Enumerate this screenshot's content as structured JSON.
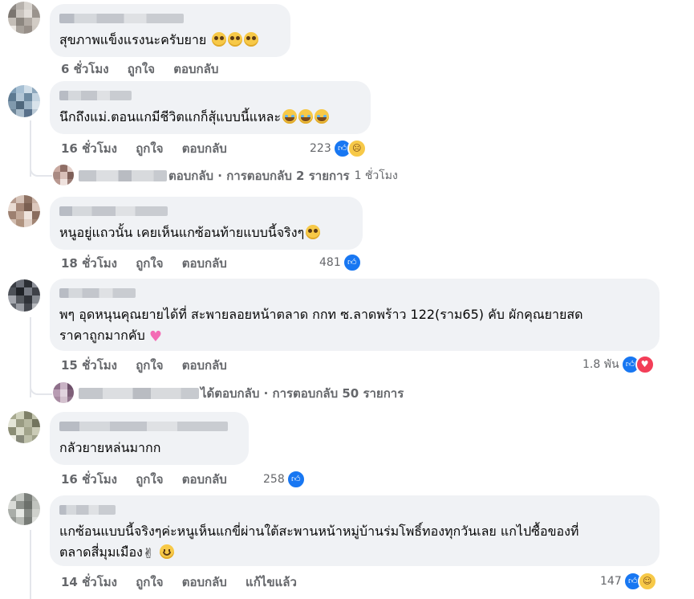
{
  "comments": [
    {
      "author": "",
      "text": "สุขภาพแข็งแรงนะครับยาย",
      "emojis": [
        "pleading-face",
        "pleading-face",
        "pleading-face"
      ],
      "time": "6 ชั่วโมง",
      "like_label": "ถูกใจ",
      "reply_label": "ตอบกลับ",
      "reaction_count": "",
      "reaction_icons": []
    },
    {
      "author": "",
      "text": "นึกถึงแม่.ตอนแกมีชีวิตแกก็สุ้แบบนี้แหละ",
      "emojis": [
        "crying-face",
        "crying-face",
        "crying-face"
      ],
      "time": "16 ชั่วโมง",
      "like_label": "ถูกใจ",
      "reply_label": "ตอบกลับ",
      "reaction_count": "223",
      "reaction_icons": [
        "like-icon",
        "sad-icon"
      ],
      "replies_summary": {
        "text": "ตอบกลับ · การตอบกลับ 2 รายการ",
        "time": "1 ชั่วโมง"
      }
    },
    {
      "author": "",
      "text": "หนูอยู่แถวนั้น เคยเห็นแกซ้อนท้ายแบบนี้จริงๆ",
      "emojis": [
        "pleading-face"
      ],
      "time": "18 ชั่วโมง",
      "like_label": "ถูกใจ",
      "reply_label": "ตอบกลับ",
      "reaction_count": "481",
      "reaction_icons": [
        "like-icon"
      ]
    },
    {
      "author": "",
      "text_line1": "พๆ อุดหนุนคุณยายได้ที่ สะพายลอยหน้าตลาด กกท ซ.ลาดพร้าว 122(ราม65) คับ ผักคุณยายสด",
      "text_line2": "ราคาถูกมากคับ",
      "emojis": [
        "pink-heart"
      ],
      "time": "15 ชั่วโมง",
      "like_label": "ถูกใจ",
      "reply_label": "ตอบกลับ",
      "reaction_count": "1.8 พัน",
      "reaction_icons": [
        "like-icon",
        "love-icon"
      ],
      "replies_summary": {
        "text": "ได้ตอบกลับ · การตอบกลับ 50 รายการ",
        "time": ""
      }
    },
    {
      "author": "",
      "text": "กลัวยายหล่นมากก",
      "emojis": [],
      "time": "16 ชั่วโมง",
      "like_label": "ถูกใจ",
      "reply_label": "ตอบกลับ",
      "reaction_count": "258",
      "reaction_icons": [
        "like-icon"
      ]
    },
    {
      "author": "",
      "text_line1": "แกซ้อนแบบนี้จริงๆค่ะหนูเห็นแกขี่ผ่านใต้สะพานหน้าหมู่บ้านร่มโพธิ์ทองทุกวันเลย แกไปซื้อของที่",
      "text_line2": "ตลาดสี่มุมเมือง",
      "emojis": [
        "victory-hand",
        "smiling-face"
      ],
      "time": "14 ชั่วโมง",
      "like_label": "ถูกใจ",
      "reply_label": "ตอบกลับ",
      "edited_label": "แก้ไขแล้ว",
      "reaction_count": "147",
      "reaction_icons": [
        "like-icon",
        "care-icon"
      ]
    }
  ],
  "colors": {
    "bubble": "#f0f2f5",
    "meta_text": "#65676b",
    "like_blue": "#1877f2",
    "love_red": "#f33e58"
  }
}
